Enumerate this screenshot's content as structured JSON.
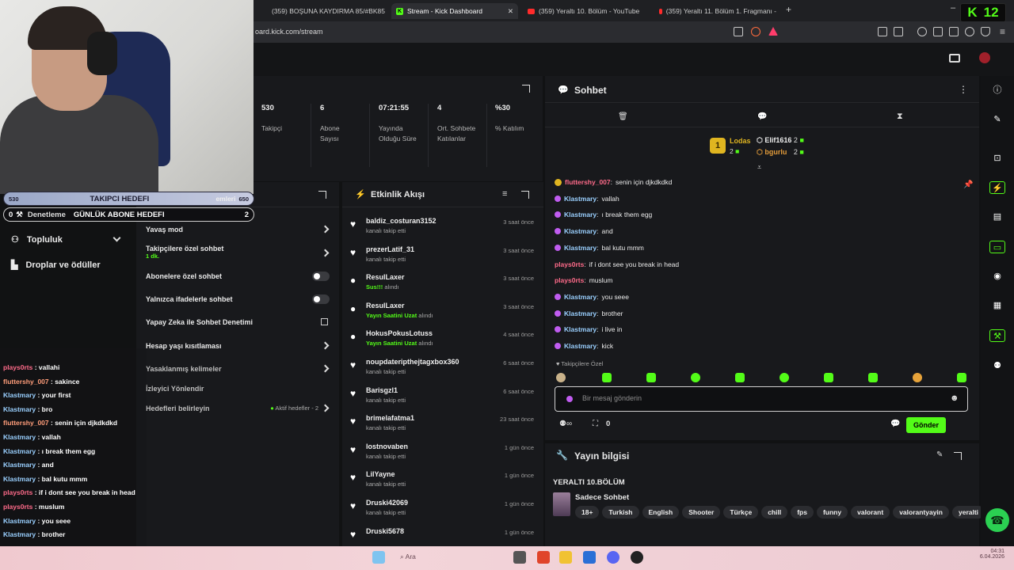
{
  "browser": {
    "tabs": [
      {
        "title": "(359) BOŞUNA KAYDIRMA 85/#BK85",
        "icon": "youtube-icon"
      },
      {
        "title": "Stream - Kick Dashboard",
        "icon": "kick-icon"
      },
      {
        "title": "(359) Yeraltı 10. Bölüm - YouTube",
        "icon": "youtube-icon"
      },
      {
        "title": "(359) Yeraltı 11. Bölüm 1. Fragmanı -",
        "icon": "youtube-icon"
      }
    ],
    "url": "oard.kick.com/stream",
    "badge": {
      "left": "K",
      "right": "12"
    }
  },
  "goals": {
    "follower_left": "530",
    "follower_label": "TAKIPCI HEDEFI",
    "follower_right": "650",
    "follower_overlap": "emleri",
    "sub_left": "0",
    "sub_mod": "Denetleme",
    "sub_label": "GÜNLÜK ABONE HEDEFI",
    "sub_right": "2"
  },
  "leftnav": {
    "community": "Topluluk",
    "drops": "Droplar ve ödüller"
  },
  "stats": [
    {
      "value": "530",
      "label": "Takipçi"
    },
    {
      "value": "6",
      "label": "Abone Sayısı"
    },
    {
      "value": "07:21:55",
      "label": "Yayında Olduğu Süre"
    },
    {
      "value": "4",
      "label": "Ort. Sohbete Katılanlar"
    },
    {
      "value": "%30",
      "label": "% Katılım"
    }
  ],
  "moderation": {
    "items": [
      {
        "label": "Yavaş mod",
        "control": "chevron"
      },
      {
        "label": "Takipçilere özel sohbet",
        "sub": "1 dk.",
        "control": "chevron"
      },
      {
        "label": "Abonelere özel sohbet",
        "control": "toggle"
      },
      {
        "label": "Yalnızca ifadelerle sohbet",
        "control": "toggle"
      },
      {
        "label": "Yapay Zeka ile Sohbet Denetimi",
        "control": "link"
      },
      {
        "label": "Hesap yaşı kısıtlaması",
        "control": "chevron"
      },
      {
        "label": "Yasaklanmış kelimeler",
        "control": "chevron"
      },
      {
        "label": "İzleyici Yönlendir",
        "control": "none"
      },
      {
        "label": "Hedefleri belirleyin",
        "status": "Aktif hedefler - 2",
        "control": "chevron"
      }
    ]
  },
  "overlay_chat": [
    {
      "user": "plays0rts",
      "text": "vallahi",
      "cls": "pink"
    },
    {
      "user": "fluttershy_007",
      "text": "sakince",
      "cls": "red"
    },
    {
      "user": "Klastmary",
      "text": "your first",
      "cls": ""
    },
    {
      "user": "Klastmary",
      "text": "bro",
      "cls": ""
    },
    {
      "user": "fluttershy_007",
      "text": "senin için djkdkdkd",
      "cls": "red"
    },
    {
      "user": "Klastmary",
      "text": "vallah",
      "cls": ""
    },
    {
      "user": "Klastmary",
      "text": "ı break them egg",
      "cls": ""
    },
    {
      "user": "Klastmary",
      "text": "and",
      "cls": ""
    },
    {
      "user": "Klastmary",
      "text": "bal kutu mmm",
      "cls": ""
    },
    {
      "user": "plays0rts",
      "text": "if i dont see you break in head",
      "cls": "pink"
    },
    {
      "user": "plays0rts",
      "text": "muslum",
      "cls": "pink"
    },
    {
      "user": "Klastmary",
      "text": "you seee",
      "cls": ""
    },
    {
      "user": "Klastmary",
      "text": "brother",
      "cls": ""
    },
    {
      "user": "Klastmary",
      "text": "i live in",
      "cls": ""
    },
    {
      "user": "Klastmary",
      "text": "kick",
      "cls": ""
    }
  ],
  "feed": {
    "title": "Etkinlik Akışı",
    "items": [
      {
        "name": "baldiz_costuran3152",
        "desc": "kanalı takip etti",
        "time": "3 saat önce",
        "icon": "heart"
      },
      {
        "name": "prezerLatif_31",
        "desc": "kanalı takip etti",
        "time": "3 saat önce",
        "icon": "heart"
      },
      {
        "name": "ResulLaxer",
        "hl": "Sus!!!",
        "desc": " alındı",
        "time": "3 saat önce",
        "icon": "reward"
      },
      {
        "name": "ResulLaxer",
        "hl": "Yayın Saatini Uzat",
        "desc": " alındı",
        "time": "3 saat önce",
        "icon": "reward"
      },
      {
        "name": "HokusPokusLotuss",
        "hl": "Yayın Saatini Uzat",
        "desc": " alındı",
        "time": "4 saat önce",
        "icon": "reward"
      },
      {
        "name": "noupdateripthejtagxbox360",
        "desc": "kanalı takip etti",
        "time": "6 saat önce",
        "icon": "heart"
      },
      {
        "name": "Barisgzl1",
        "desc": "kanalı takip etti",
        "time": "6 saat önce",
        "icon": "heart"
      },
      {
        "name": "brimelafatma1",
        "desc": "kanalı takip etti",
        "time": "23 saat önce",
        "icon": "heart"
      },
      {
        "name": "lostnovaben",
        "desc": "kanalı takip etti",
        "time": "1 gün önce",
        "icon": "heart"
      },
      {
        "name": "LilYayne",
        "desc": "kanalı takip etti",
        "time": "1 gün önce",
        "icon": "heart"
      },
      {
        "name": "Druski42069",
        "desc": "kanalı takip etti",
        "time": "1 gün önce",
        "icon": "heart"
      },
      {
        "name": "Druski5678",
        "desc": "",
        "time": "1 gün önce",
        "icon": "heart"
      }
    ]
  },
  "chat": {
    "title": "Sohbet",
    "leaders": {
      "first": "Lodas",
      "first_count": "2",
      "second": "Elif1616",
      "second_count": "2",
      "third": "bgurlu",
      "third_count": "2"
    },
    "messages": [
      {
        "user": "fluttershy_007",
        "text": "senin için djkdkdkd",
        "cls": "pink",
        "mic": false
      },
      {
        "user": "Klastmary",
        "text": "vallah",
        "cls": "",
        "mic": true
      },
      {
        "user": "Klastmary",
        "text": "ı break them egg",
        "cls": "",
        "mic": true
      },
      {
        "user": "Klastmary",
        "text": "and",
        "cls": "",
        "mic": true
      },
      {
        "user": "Klastmary",
        "text": "bal kutu mmm",
        "cls": "",
        "mic": true
      },
      {
        "user": "plays0rts",
        "text": "if i dont see you break in head",
        "cls": "pink",
        "mic": false
      },
      {
        "user": "plays0rts",
        "text": "muslum",
        "cls": "pink",
        "mic": false
      },
      {
        "user": "Klastmary",
        "text": "you seee",
        "cls": "",
        "mic": true
      },
      {
        "user": "Klastmary",
        "text": "brother",
        "cls": "",
        "mic": true
      },
      {
        "user": "Klastmary",
        "text": "i live in",
        "cls": "",
        "mic": true
      },
      {
        "user": "Klastmary",
        "text": "kick",
        "cls": "",
        "mic": true
      }
    ],
    "followers_only": "Takipçilere Özel",
    "placeholder": "Bir mesaj gönderin",
    "points": "0",
    "send": "Gönder"
  },
  "info": {
    "title": "Yayın bilgisi",
    "stream_title": "YERALTI 10.BÖLÜM",
    "category": "Sadece Sohbet",
    "tags": [
      "18+",
      "Turkish",
      "English",
      "Shooter",
      "Türkçe",
      "chill",
      "fps",
      "funny",
      "valorant",
      "valorantyayin",
      "yeralti"
    ]
  },
  "taskbar": {
    "search": "Ara",
    "time": "04:31",
    "date": "6.04.2026"
  },
  "colors": {
    "accent": "#53fc18",
    "panel": "#18191c",
    "bg": "#111213"
  }
}
